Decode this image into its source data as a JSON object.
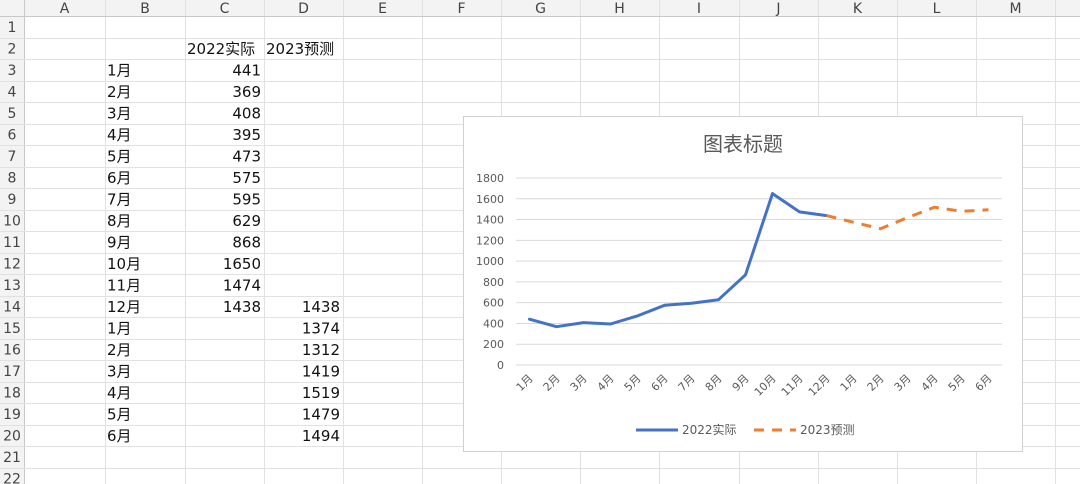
{
  "sheet": {
    "columns": [
      "A",
      "B",
      "C",
      "D",
      "E",
      "F",
      "G",
      "H",
      "I",
      "J",
      "K",
      "L",
      "M"
    ],
    "row_numbers": [
      "1",
      "2",
      "3",
      "4",
      "5",
      "6",
      "7",
      "8",
      "9",
      "10",
      "11",
      "12",
      "13",
      "14",
      "15",
      "16",
      "17",
      "18",
      "19",
      "20",
      "21",
      "22"
    ],
    "cells": [
      {
        "row": 2,
        "col": "C",
        "text": "2022实际",
        "align": "left"
      },
      {
        "row": 2,
        "col": "D",
        "text": "2023预测",
        "align": "left"
      },
      {
        "row": 3,
        "col": "B",
        "text": "1月",
        "align": "left"
      },
      {
        "row": 3,
        "col": "C",
        "text": "441",
        "align": "right"
      },
      {
        "row": 4,
        "col": "B",
        "text": "2月",
        "align": "left"
      },
      {
        "row": 4,
        "col": "C",
        "text": "369",
        "align": "right"
      },
      {
        "row": 5,
        "col": "B",
        "text": "3月",
        "align": "left"
      },
      {
        "row": 5,
        "col": "C",
        "text": "408",
        "align": "right"
      },
      {
        "row": 6,
        "col": "B",
        "text": "4月",
        "align": "left"
      },
      {
        "row": 6,
        "col": "C",
        "text": "395",
        "align": "right"
      },
      {
        "row": 7,
        "col": "B",
        "text": "5月",
        "align": "left"
      },
      {
        "row": 7,
        "col": "C",
        "text": "473",
        "align": "right"
      },
      {
        "row": 8,
        "col": "B",
        "text": "6月",
        "align": "left"
      },
      {
        "row": 8,
        "col": "C",
        "text": "575",
        "align": "right"
      },
      {
        "row": 9,
        "col": "B",
        "text": "7月",
        "align": "left"
      },
      {
        "row": 9,
        "col": "C",
        "text": "595",
        "align": "right"
      },
      {
        "row": 10,
        "col": "B",
        "text": "8月",
        "align": "left"
      },
      {
        "row": 10,
        "col": "C",
        "text": "629",
        "align": "right"
      },
      {
        "row": 11,
        "col": "B",
        "text": "9月",
        "align": "left"
      },
      {
        "row": 11,
        "col": "C",
        "text": "868",
        "align": "right"
      },
      {
        "row": 12,
        "col": "B",
        "text": "10月",
        "align": "left"
      },
      {
        "row": 12,
        "col": "C",
        "text": "1650",
        "align": "right"
      },
      {
        "row": 13,
        "col": "B",
        "text": "11月",
        "align": "left"
      },
      {
        "row": 13,
        "col": "C",
        "text": "1474",
        "align": "right"
      },
      {
        "row": 14,
        "col": "B",
        "text": "12月",
        "align": "left"
      },
      {
        "row": 14,
        "col": "C",
        "text": "1438",
        "align": "right"
      },
      {
        "row": 14,
        "col": "D",
        "text": "1438",
        "align": "right"
      },
      {
        "row": 15,
        "col": "B",
        "text": "1月",
        "align": "left"
      },
      {
        "row": 15,
        "col": "D",
        "text": "1374",
        "align": "right"
      },
      {
        "row": 16,
        "col": "B",
        "text": "2月",
        "align": "left"
      },
      {
        "row": 16,
        "col": "D",
        "text": "1312",
        "align": "right"
      },
      {
        "row": 17,
        "col": "B",
        "text": "3月",
        "align": "left"
      },
      {
        "row": 17,
        "col": "D",
        "text": "1419",
        "align": "right"
      },
      {
        "row": 18,
        "col": "B",
        "text": "4月",
        "align": "left"
      },
      {
        "row": 18,
        "col": "D",
        "text": "1519",
        "align": "right"
      },
      {
        "row": 19,
        "col": "B",
        "text": "5月",
        "align": "left"
      },
      {
        "row": 19,
        "col": "D",
        "text": "1479",
        "align": "right"
      },
      {
        "row": 20,
        "col": "B",
        "text": "6月",
        "align": "left"
      },
      {
        "row": 20,
        "col": "D",
        "text": "1494",
        "align": "right"
      }
    ]
  },
  "chart_data": {
    "type": "line",
    "title": "图表标题",
    "categories": [
      "1月",
      "2月",
      "3月",
      "4月",
      "5月",
      "6月",
      "7月",
      "8月",
      "9月",
      "10月",
      "11月",
      "12月",
      "1月",
      "2月",
      "3月",
      "4月",
      "5月",
      "6月"
    ],
    "ylim": [
      0,
      1800
    ],
    "yticks": [
      "0",
      "200",
      "400",
      "600",
      "800",
      "1000",
      "1200",
      "1400",
      "1600",
      "1800"
    ],
    "grid": true,
    "legend_position": "bottom",
    "series": [
      {
        "name": "2022实际",
        "color": "#4472C4",
        "dash": "solid",
        "values": [
          441,
          369,
          408,
          395,
          473,
          575,
          595,
          629,
          868,
          1650,
          1474,
          1438,
          null,
          null,
          null,
          null,
          null,
          null
        ]
      },
      {
        "name": "2023预测",
        "color": "#ED7D31",
        "dash": "dashed",
        "values": [
          null,
          null,
          null,
          null,
          null,
          null,
          null,
          null,
          null,
          null,
          null,
          1438,
          1374,
          1312,
          1419,
          1519,
          1479,
          1494
        ]
      }
    ]
  }
}
